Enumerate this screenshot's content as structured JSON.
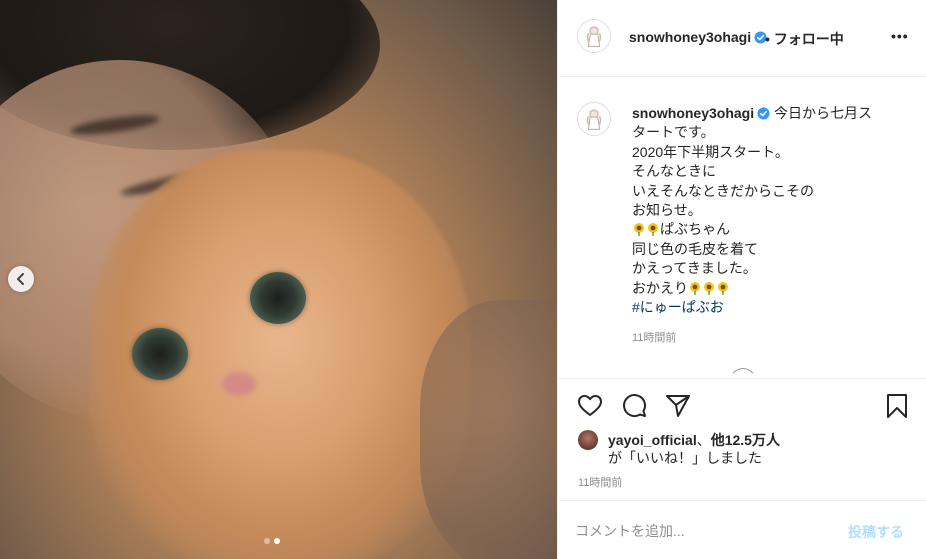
{
  "post": {
    "slide_count": 2,
    "active_slide": 2
  },
  "header": {
    "username": "snowhoney3ohagi",
    "separator": "•",
    "follow_status": "フォロー中",
    "more": "•••"
  },
  "caption": {
    "username": "snowhoney3ohagi",
    "lines": [
      "今日から七月ス",
      "タートです。",
      "2020年下半期スタート。",
      "そんなときに",
      "いえそんなときだからこその",
      "お知らせ。",
      "ぱぶちゃん",
      "同じ色の毛皮を着て",
      "かえってきました。",
      "おかえり"
    ],
    "hashtag": "#にゅーぱぶお",
    "time": "11時間前"
  },
  "likes": {
    "user": "yayoi_official",
    "sep": "、",
    "others": "他12.5万人",
    "suffix": "が「いいね！」しました"
  },
  "timestamp": "11時間前",
  "comment": {
    "placeholder": "コメントを追加...",
    "post_label": "投稿する"
  },
  "colors": {
    "verified": "#3897f0",
    "link": "#00376b",
    "post_disabled": "#b2dffc",
    "muted": "#8e8e8e"
  },
  "icons": {
    "heart": "heart-icon",
    "comment": "comment-icon",
    "share": "paper-plane-icon",
    "save": "bookmark-icon",
    "flower": "sunflower-icon"
  }
}
